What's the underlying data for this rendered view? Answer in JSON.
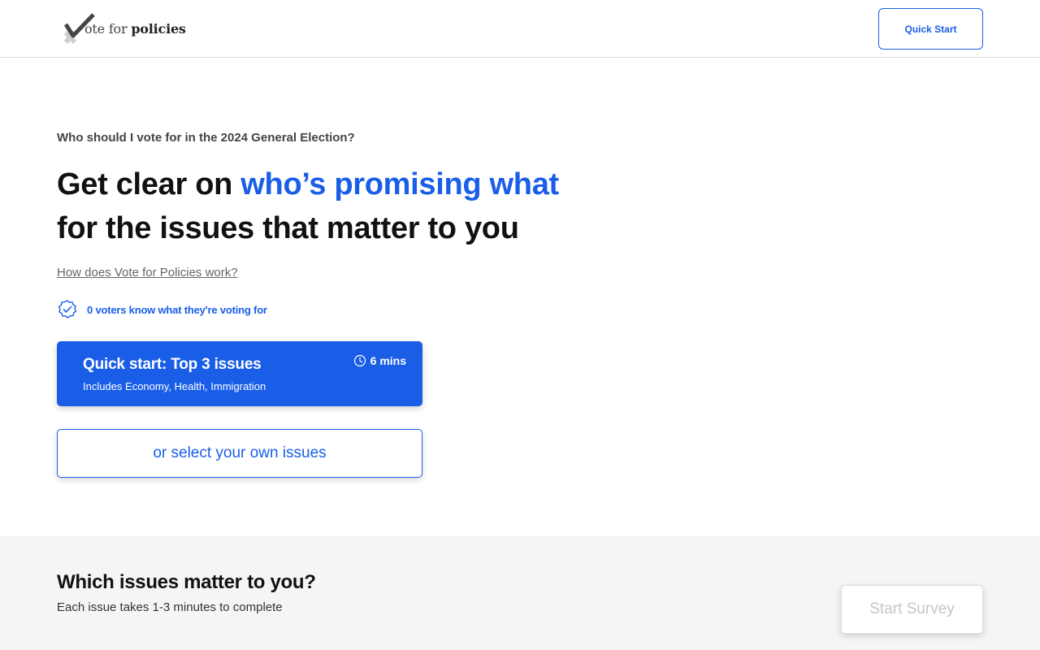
{
  "header": {
    "logo_text_prefix": "ote for ",
    "logo_text_bold": "policies",
    "quick_start_label": "Quick Start"
  },
  "hero": {
    "eyebrow": "Who should I vote for in the 2024 General Election?",
    "title_part1": "Get clear on ",
    "title_accent": "who’s promising what",
    "title_part2": "for the issues that matter to you",
    "how_link": "How does Vote for Policies work?",
    "voters_text": "0 voters know what they're voting for"
  },
  "quick_start_card": {
    "title": "Quick start: Top 3 issues",
    "subtitle": "Includes Economy, Health, Immigration",
    "time": "6 mins"
  },
  "select_own": {
    "label": "or select your own issues"
  },
  "issues_section": {
    "title": "Which issues matter to you?",
    "subtitle": "Each issue takes 1-3 minutes to complete",
    "start_survey_label": "Start Survey"
  },
  "colors": {
    "accent": "#1a5ee8",
    "section_bg": "#f4f5f7",
    "disabled_text": "#c6c6c6"
  },
  "icons": [
    "check-mark-logo-icon",
    "verified-badge-icon",
    "clock-icon"
  ]
}
